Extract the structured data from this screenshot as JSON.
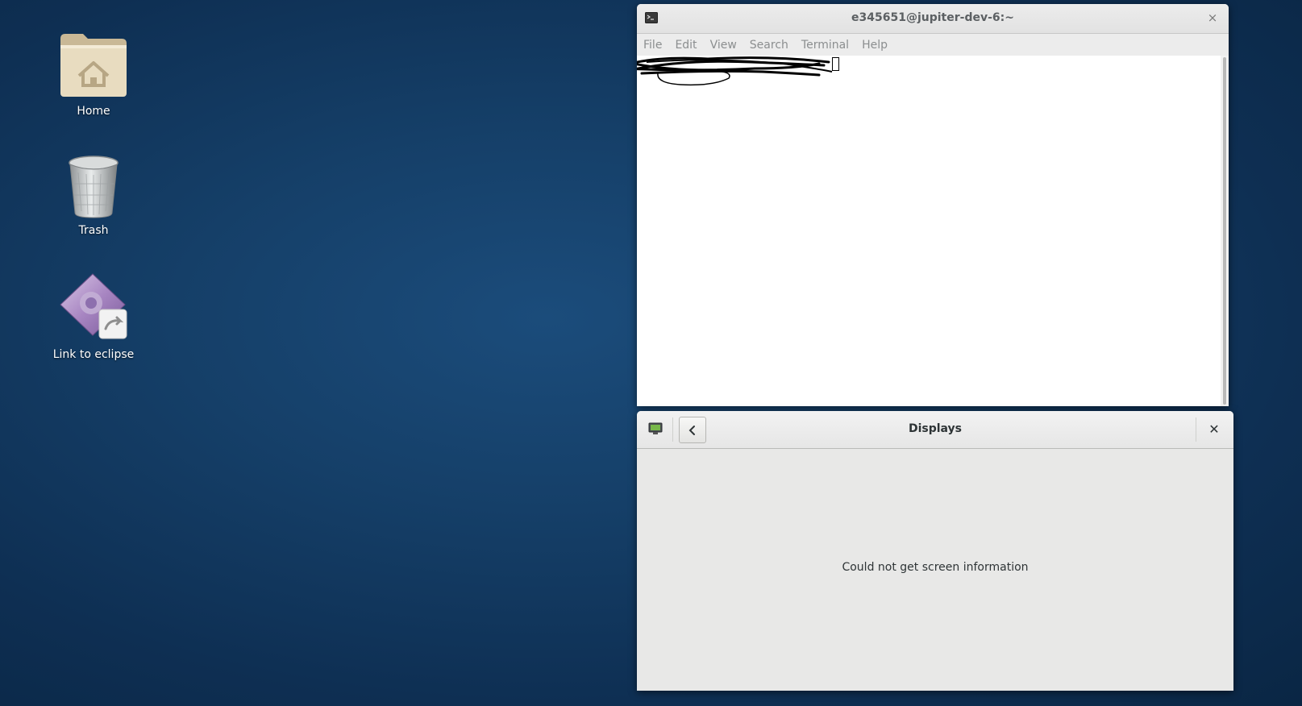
{
  "desktop": {
    "icons": [
      {
        "label": "Home",
        "icon": "home-folder-icon"
      },
      {
        "label": "Trash",
        "icon": "trash-icon"
      },
      {
        "label": "Link to eclipse",
        "icon": "eclipse-link-icon"
      }
    ]
  },
  "terminal": {
    "title": "e345651@jupiter-dev-6:~",
    "close_glyph": "×",
    "menu": [
      "File",
      "Edit",
      "View",
      "Search",
      "Terminal",
      "Help"
    ]
  },
  "displays": {
    "title": "Displays",
    "close_glyph": "✕",
    "message": "Could not get screen information"
  }
}
